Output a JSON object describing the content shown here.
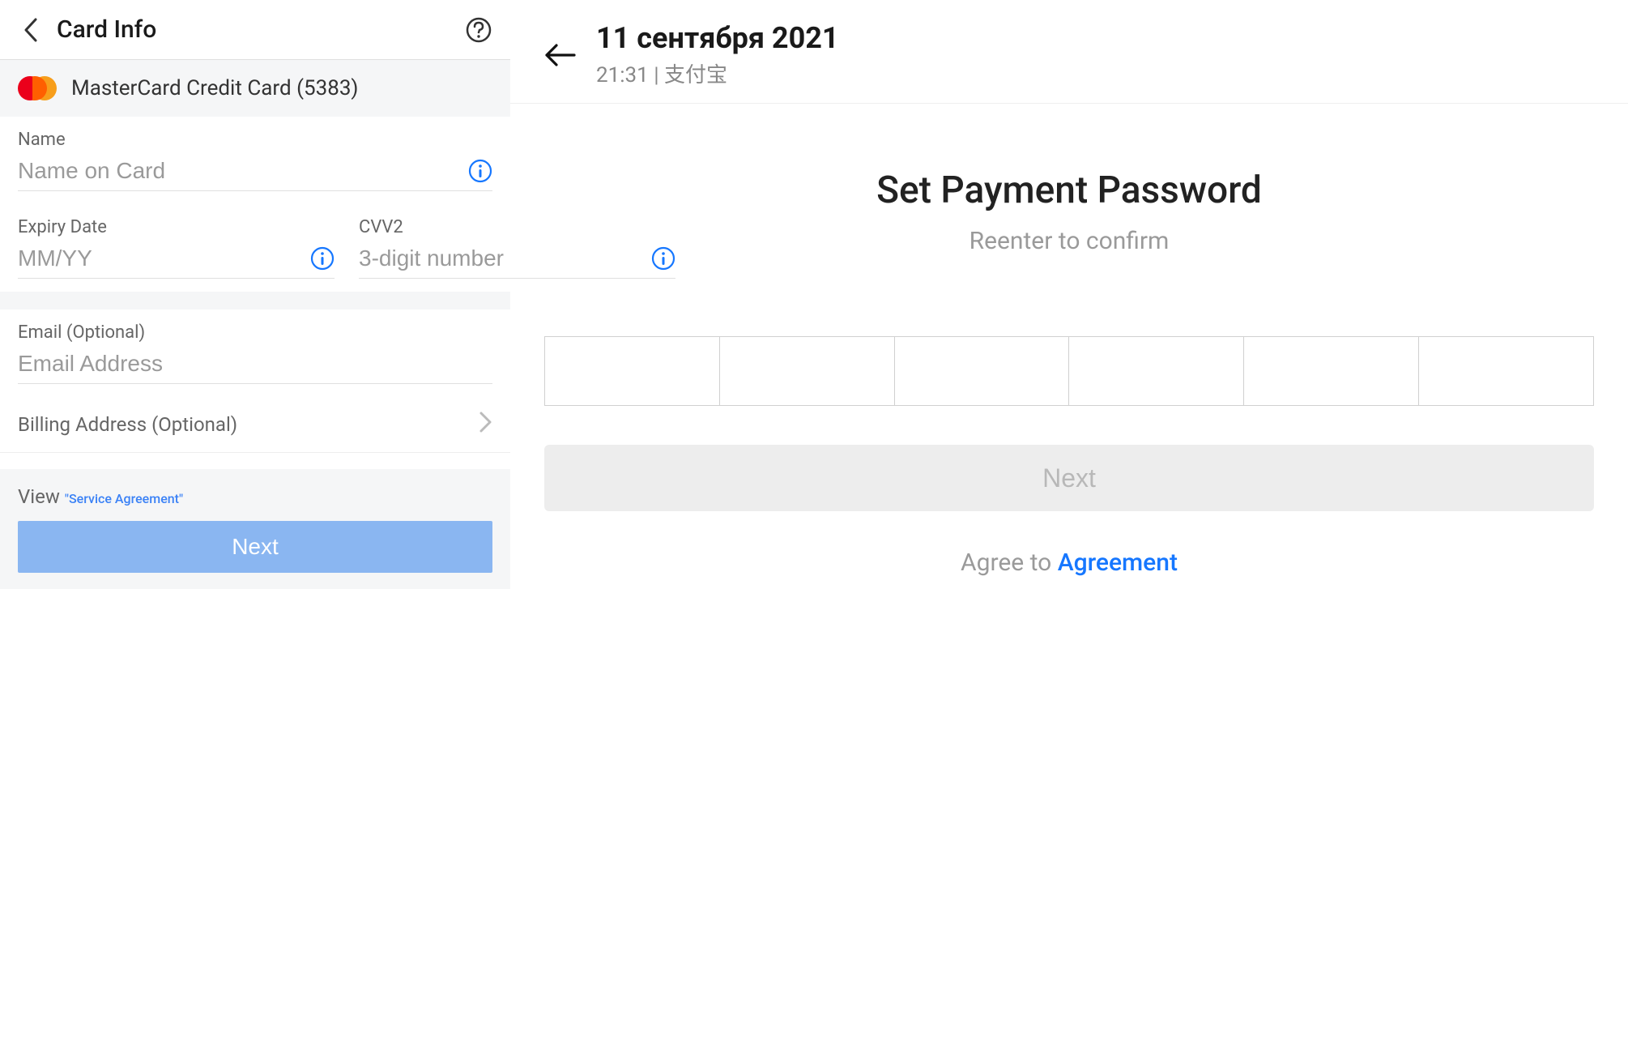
{
  "left": {
    "title": "Card Info",
    "card_strip": "MasterCard Credit Card (5383)",
    "name_label": "Name",
    "name_placeholder": "Name on Card",
    "expiry_label": "Expiry Date",
    "expiry_placeholder": "MM/YY",
    "cvv_label": "CVV2",
    "cvv_placeholder": "3-digit number",
    "email_label": "Email (Optional)",
    "email_placeholder": "Email Address",
    "billing_label": "Billing Address (Optional)",
    "view_text": "View ",
    "agreement_text": "\"Service Agreement\"",
    "next_label": "Next"
  },
  "right": {
    "date": "11 сентября 2021",
    "meta": "21:31 | 支付宝",
    "title": "Set Payment Password",
    "subtitle": "Reenter to confirm",
    "next_label": "Next",
    "agree_text": "Agree to ",
    "agree_link": "Agreement"
  }
}
